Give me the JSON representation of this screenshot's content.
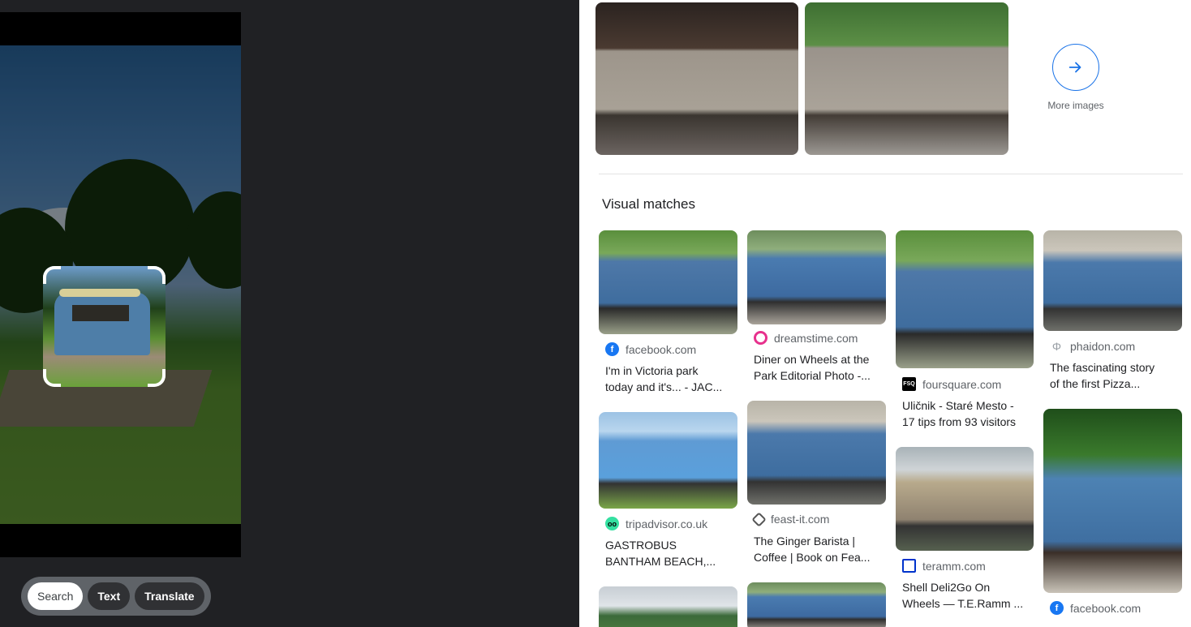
{
  "lens": {
    "modes": [
      "Search",
      "Text",
      "Translate"
    ],
    "active_mode": "Search"
  },
  "results": {
    "more_images_label": "More images",
    "visual_matches_title": "Visual matches",
    "matches": [
      {
        "source": "facebook.com",
        "title_line1": "I'm in Victoria park",
        "title_line2": "today and it's... - JAC..."
      },
      {
        "source": "dreamstime.com",
        "title_line1": "Diner on Wheels at the",
        "title_line2": "Park Editorial Photo -..."
      },
      {
        "source": "foursquare.com",
        "title_line1": "Uličnik - Staré Mesto -",
        "title_line2": "17 tips from 93 visitors"
      },
      {
        "source": "phaidon.com",
        "title_line1": "The fascinating story",
        "title_line2": "of the first Pizza..."
      },
      {
        "source": "tripadvisor.co.uk",
        "title_line1": "GASTROBUS",
        "title_line2": "BANTHAM BEACH,..."
      },
      {
        "source": "feast-it.com",
        "title_line1": "The Ginger Barista |",
        "title_line2": "Coffee | Book on Fea..."
      },
      {
        "source": "teramm.com",
        "title_line1": "Shell Deli2Go On",
        "title_line2": "Wheels — T.E.Ramm ..."
      },
      {
        "source": "facebook.com",
        "title_line1": "",
        "title_line2": ""
      }
    ]
  },
  "icons": {
    "arrow": "arrow-right-icon",
    "favicons": [
      "facebook-icon",
      "dreamstime-icon",
      "foursquare-icon",
      "phaidon-icon",
      "tripadvisor-icon",
      "feast-it-icon",
      "teramm-icon",
      "facebook-icon"
    ]
  },
  "colors": {
    "accent": "#1a73e8",
    "panel_dark": "#202124",
    "mode_bar": "#5f6368"
  }
}
